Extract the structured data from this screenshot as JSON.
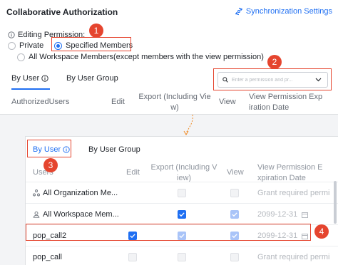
{
  "top": {
    "title": "Collaborative Authorization",
    "sync_link": "Synchronization Settings",
    "editing_permission_label": "Editing Permission:",
    "radio_private": "Private",
    "radio_specified": "Specified Members",
    "radio_all": "All Workspace Members(except members with the view permission)",
    "tab_by_user": "By User",
    "tab_by_group": "By User Group",
    "search_placeholder": "Enter a permission and pr...",
    "col_authorized_users": "AuthorizedUsers",
    "col_edit": "Edit",
    "col_export_l1": "Export (Including Vie",
    "col_export_l2": "w)",
    "col_view": "View",
    "col_expiration_l1": "View Permission Exp",
    "col_expiration_l2": "iration Date"
  },
  "bottom": {
    "tab_by_user": "By User",
    "tab_by_group": "By User Group",
    "col_users": "Users",
    "col_edit": "Edit",
    "col_export_l1": "Export (Including V",
    "col_export_l2": "iew)",
    "col_view": "View",
    "col_expiration_l1": "View Permission E",
    "col_expiration_l2": "xpiration Date",
    "rows": [
      {
        "name": "All Organization Me...",
        "icon": "organization-icon",
        "edit": "none",
        "export": "off-dim",
        "view": "off-dim",
        "expiration": "Grant required permi"
      },
      {
        "name": "All Workspace Mem...",
        "icon": "workspace-icon",
        "edit": "none",
        "export": "on",
        "view": "on-dim",
        "expiration": "2099-12-31"
      },
      {
        "name": "pop_call2",
        "icon": "",
        "edit": "on",
        "export": "on-dim",
        "view": "on-dim",
        "expiration": "2099-12-31"
      },
      {
        "name": "pop_call",
        "icon": "",
        "edit": "off-dim",
        "export": "off-dim",
        "view": "off-dim",
        "expiration": "Grant required permi"
      }
    ]
  },
  "badges": [
    "1",
    "2",
    "3",
    "4"
  ],
  "colors": {
    "accent": "#1f6ff2",
    "annotation": "#e5452f",
    "connector": "#f08a24"
  }
}
